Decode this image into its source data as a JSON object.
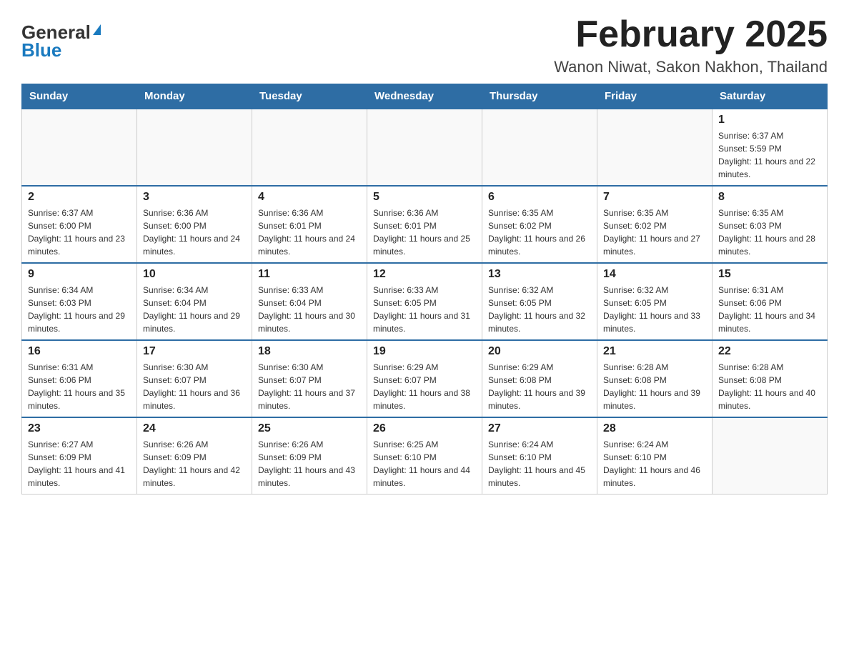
{
  "header": {
    "logo_general": "General",
    "logo_blue": "Blue",
    "title": "February 2025",
    "subtitle": "Wanon Niwat, Sakon Nakhon, Thailand"
  },
  "days_of_week": [
    "Sunday",
    "Monday",
    "Tuesday",
    "Wednesday",
    "Thursday",
    "Friday",
    "Saturday"
  ],
  "weeks": [
    [
      {
        "day": "",
        "info": ""
      },
      {
        "day": "",
        "info": ""
      },
      {
        "day": "",
        "info": ""
      },
      {
        "day": "",
        "info": ""
      },
      {
        "day": "",
        "info": ""
      },
      {
        "day": "",
        "info": ""
      },
      {
        "day": "1",
        "info": "Sunrise: 6:37 AM\nSunset: 5:59 PM\nDaylight: 11 hours and 22 minutes."
      }
    ],
    [
      {
        "day": "2",
        "info": "Sunrise: 6:37 AM\nSunset: 6:00 PM\nDaylight: 11 hours and 23 minutes."
      },
      {
        "day": "3",
        "info": "Sunrise: 6:36 AM\nSunset: 6:00 PM\nDaylight: 11 hours and 24 minutes."
      },
      {
        "day": "4",
        "info": "Sunrise: 6:36 AM\nSunset: 6:01 PM\nDaylight: 11 hours and 24 minutes."
      },
      {
        "day": "5",
        "info": "Sunrise: 6:36 AM\nSunset: 6:01 PM\nDaylight: 11 hours and 25 minutes."
      },
      {
        "day": "6",
        "info": "Sunrise: 6:35 AM\nSunset: 6:02 PM\nDaylight: 11 hours and 26 minutes."
      },
      {
        "day": "7",
        "info": "Sunrise: 6:35 AM\nSunset: 6:02 PM\nDaylight: 11 hours and 27 minutes."
      },
      {
        "day": "8",
        "info": "Sunrise: 6:35 AM\nSunset: 6:03 PM\nDaylight: 11 hours and 28 minutes."
      }
    ],
    [
      {
        "day": "9",
        "info": "Sunrise: 6:34 AM\nSunset: 6:03 PM\nDaylight: 11 hours and 29 minutes."
      },
      {
        "day": "10",
        "info": "Sunrise: 6:34 AM\nSunset: 6:04 PM\nDaylight: 11 hours and 29 minutes."
      },
      {
        "day": "11",
        "info": "Sunrise: 6:33 AM\nSunset: 6:04 PM\nDaylight: 11 hours and 30 minutes."
      },
      {
        "day": "12",
        "info": "Sunrise: 6:33 AM\nSunset: 6:05 PM\nDaylight: 11 hours and 31 minutes."
      },
      {
        "day": "13",
        "info": "Sunrise: 6:32 AM\nSunset: 6:05 PM\nDaylight: 11 hours and 32 minutes."
      },
      {
        "day": "14",
        "info": "Sunrise: 6:32 AM\nSunset: 6:05 PM\nDaylight: 11 hours and 33 minutes."
      },
      {
        "day": "15",
        "info": "Sunrise: 6:31 AM\nSunset: 6:06 PM\nDaylight: 11 hours and 34 minutes."
      }
    ],
    [
      {
        "day": "16",
        "info": "Sunrise: 6:31 AM\nSunset: 6:06 PM\nDaylight: 11 hours and 35 minutes."
      },
      {
        "day": "17",
        "info": "Sunrise: 6:30 AM\nSunset: 6:07 PM\nDaylight: 11 hours and 36 minutes."
      },
      {
        "day": "18",
        "info": "Sunrise: 6:30 AM\nSunset: 6:07 PM\nDaylight: 11 hours and 37 minutes."
      },
      {
        "day": "19",
        "info": "Sunrise: 6:29 AM\nSunset: 6:07 PM\nDaylight: 11 hours and 38 minutes."
      },
      {
        "day": "20",
        "info": "Sunrise: 6:29 AM\nSunset: 6:08 PM\nDaylight: 11 hours and 39 minutes."
      },
      {
        "day": "21",
        "info": "Sunrise: 6:28 AM\nSunset: 6:08 PM\nDaylight: 11 hours and 39 minutes."
      },
      {
        "day": "22",
        "info": "Sunrise: 6:28 AM\nSunset: 6:08 PM\nDaylight: 11 hours and 40 minutes."
      }
    ],
    [
      {
        "day": "23",
        "info": "Sunrise: 6:27 AM\nSunset: 6:09 PM\nDaylight: 11 hours and 41 minutes."
      },
      {
        "day": "24",
        "info": "Sunrise: 6:26 AM\nSunset: 6:09 PM\nDaylight: 11 hours and 42 minutes."
      },
      {
        "day": "25",
        "info": "Sunrise: 6:26 AM\nSunset: 6:09 PM\nDaylight: 11 hours and 43 minutes."
      },
      {
        "day": "26",
        "info": "Sunrise: 6:25 AM\nSunset: 6:10 PM\nDaylight: 11 hours and 44 minutes."
      },
      {
        "day": "27",
        "info": "Sunrise: 6:24 AM\nSunset: 6:10 PM\nDaylight: 11 hours and 45 minutes."
      },
      {
        "day": "28",
        "info": "Sunrise: 6:24 AM\nSunset: 6:10 PM\nDaylight: 11 hours and 46 minutes."
      },
      {
        "day": "",
        "info": ""
      }
    ]
  ]
}
